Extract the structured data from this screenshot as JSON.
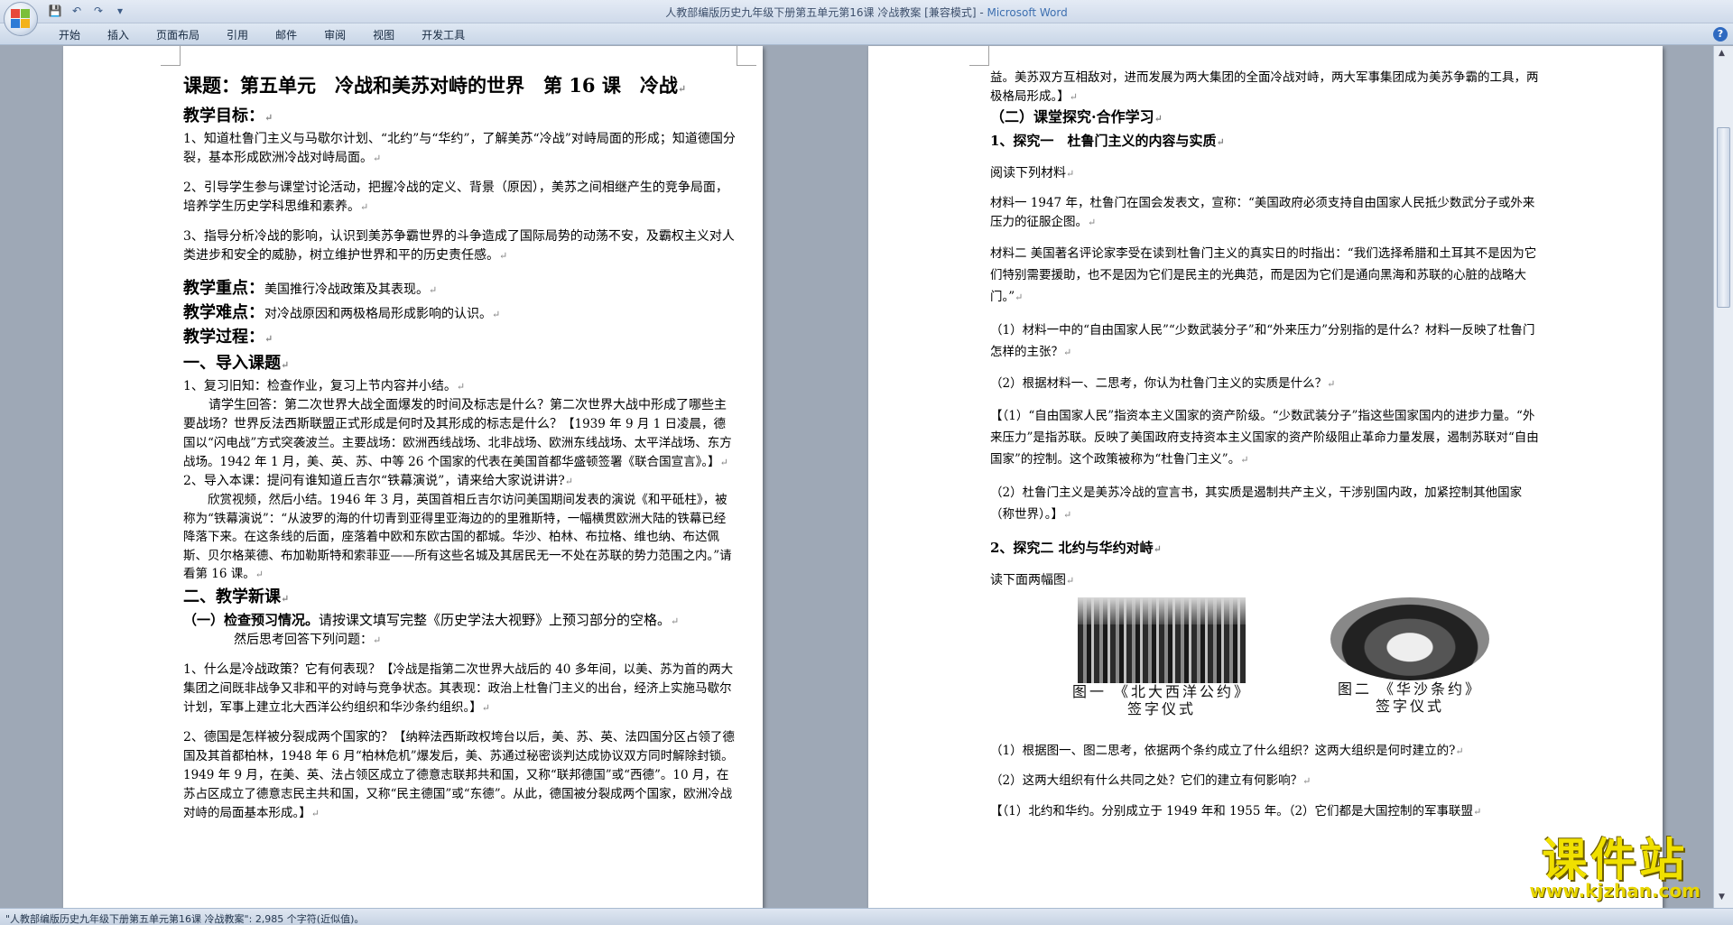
{
  "window": {
    "title": "人教部编版历史九年级下册第五单元第16课 冷战教案 [兼容模式]",
    "app_name": "Microsoft Word",
    "title_sep": " - "
  },
  "qat": {
    "save": "💾",
    "undo": "↶",
    "redo": "↷",
    "customize": "▾"
  },
  "ribbon": {
    "tabs": [
      "开始",
      "插入",
      "页面布局",
      "引用",
      "邮件",
      "审阅",
      "视图",
      "开发工具"
    ],
    "help": "?"
  },
  "left_page": {
    "title": "课题：第五单元　冷战和美苏对峙的世界　第 16 课　冷战",
    "goals_label": "教学目标：",
    "goal1": "1、知道杜鲁门主义与马歇尔计划、“北约”与“华约”，了解美苏“冷战”对峙局面的形成；知道德国分裂，基本形成欧洲冷战对峙局面。",
    "goal2": "2、引导学生参与课堂讨论活动，把握冷战的定义、背景（原因），美苏之间相继产生的竞争局面，培养学生历史学科思维和素养。",
    "goal3": "3、指导分析冷战的影响，认识到美苏争霸世界的斗争造成了国际局势的动荡不安，及霸权主义对人类进步和安全的威胁，树立维护世界和平的历史责任感。",
    "key_label": "教学重点：",
    "key_text": "美国推行冷战政策及其表现。",
    "diff_label": "教学难点：",
    "diff_text": "对冷战原因和两极格局形成影响的认识。",
    "process_label": "教学过程：",
    "sec1": "一、导入课题",
    "review": "1、复习旧知：检查作业，复习上节内容并小结。",
    "review_q": "请学生回答：第二次世界大战全面爆发的时间及标志是什么？第二次世界大战中形成了哪些主要战场？世界反法西斯联盟正式形成是何时及其形成的标志是什么？",
    "review_a": "【1939 年 9 月 1 日凌晨，德国以“闪电战”方式突袭波兰。主要战场：欧洲西线战场、北非战场、欧洲东线战场、太平洋战场、东方战场。1942 年 1 月，美、英、苏、中等 26 个国家的代表在美国首都华盛顿签署《联合国宣言》。】",
    "intro": "2、导入本课：提问有谁知道丘吉尔“铁幕演说”，请来给大家说讲讲?",
    "intro_text": "欣赏视频，然后小结。1946 年 3 月，英国首相丘吉尔访问美国期间发表的演说《和平砥柱》，被称为“铁幕演说”：“从波罗的海的什切青到亚得里亚海边的的里雅斯特，一幅横贯欧洲大陆的铁幕已经降落下来。在这条线的后面，座落着中欧和东欧古国的都城。华沙、柏林、布拉格、维也纳、布达佩斯、贝尔格莱德、布加勒斯特和索菲亚——所有这些名城及其居民无一不处在苏联的势力范围之内。”请看第 16 课。",
    "sec2": "二、教学新课",
    "sub1_label": "（一）检查预习情况。",
    "sub1_text": "请按课文填写完整《历史学法大视野》上预习部分的空格。",
    "sub1_line2": "然后思考回答下列问题：",
    "q1": "1、什么是冷战政策？它有何表现？",
    "a1": "【冷战是指第二次世界大战后的 40 多年间，以美、苏为首的两大集团之间既非战争又非和平的对峙与竞争状态。其表现：政治上杜鲁门主义的出台，经济上实施马歇尔计划，军事上建立北大西洋公约组织和华沙条约组织。】",
    "q2": "2、德国是怎样被分裂成两个国家的？",
    "a2": "【纳粹法西斯政权垮台以后，美、苏、英、法四国分区占领了德国及其首都柏林，1948 年 6 月“柏林危机”爆发后，美、苏通过秘密谈判达成协议双方同时解除封锁。1949 年 9 月，在美、英、法占领区成立了德意志联邦共和国，又称“联邦德国”或“西德”。10 月，在苏占区成立了德意志民主共和国，又称“民主德国”或“东德”。从此，德国被分裂成两个国家，欧洲冷战对峙的局面基本形成。】"
  },
  "right_page": {
    "cont": "益。美苏双方互相敌对，进而发展为两大集团的全面冷战对峙，两大军事集团成为美苏争霸的工具，两极格局形成。】",
    "sub2": "（二）课堂探究·合作学习",
    "explore1": "1、探究一　杜鲁门主义的内容与实质",
    "read1": "阅读下列材料",
    "mat1": "材料一 1947 年，杜鲁门在国会发表文，宣称：“美国政府必须支持自由国家人民抵少数武分子或外来压力的征服企图。",
    "mat2": "材料二 美国著名评论家李受在读到杜鲁门主义的真实日的时指出：“我们选择希腊和土耳其不是因为它们特别需要援助，也不是因为它们是民主的光典范，而是因为它们是通向黑海和苏联的心脏的战略大门。”",
    "q1": "（1）材料一中的“自由国家人民”“少数武装分子”和“外来压力”分别指的是什么？材料一反映了杜鲁门怎样的主张？",
    "q2": "（2）根据材料一、二思考，你认为杜鲁门主义的实质是什么？",
    "a1": "【（1）“自由国家人民”指资本主义国家的资产阶级。“少数武装分子”指这些国家国内的进步力量。“外来压力”是指苏联。反映了美国政府支持资本主义国家的资产阶级阻止革命力量发展，遏制苏联对“自由国家”的控制。这个政策被称为“杜鲁门主义”。",
    "a2": "（2）杜鲁门主义是美苏冷战的宣言书，其实质是遏制共产主义，干涉别国内政，加紧控制其他国家（称世界）。】",
    "explore2": "2、探究二 北约与华约对峙",
    "read2": "读下面两幅图",
    "fig1_caption_1": "图一 《北大西洋公约》",
    "fig1_caption_2": "签字仪式",
    "fig2_caption_1": "图二 《华沙条约》",
    "fig2_caption_2": "签字仪式",
    "fq1": "（1）根据图一、图二思考，依据两个条约成立了什么组织？这两大组织是何时建立的?",
    "fq2": "（2）这两大组织有什么共同之处？它们的建立有何影响？",
    "fa1": "【（1）北约和华约。分别成立于 1949 年和 1955 年。（2）它们都是大国控制的军事联盟"
  },
  "status_bar": {
    "text": "\"人教部编版历史九年级下册第五单元第16课 冷战教案\": 2,985 个字符(近似值)。"
  },
  "watermark": {
    "name": "课件站",
    "url": "www.kjzhan.com"
  },
  "colors": {
    "title_blue": "#3d6fb0",
    "watermark": "#f0e000",
    "page": "#ffffff",
    "workspace": "#9ea8b6"
  },
  "pilcrow": "↵"
}
